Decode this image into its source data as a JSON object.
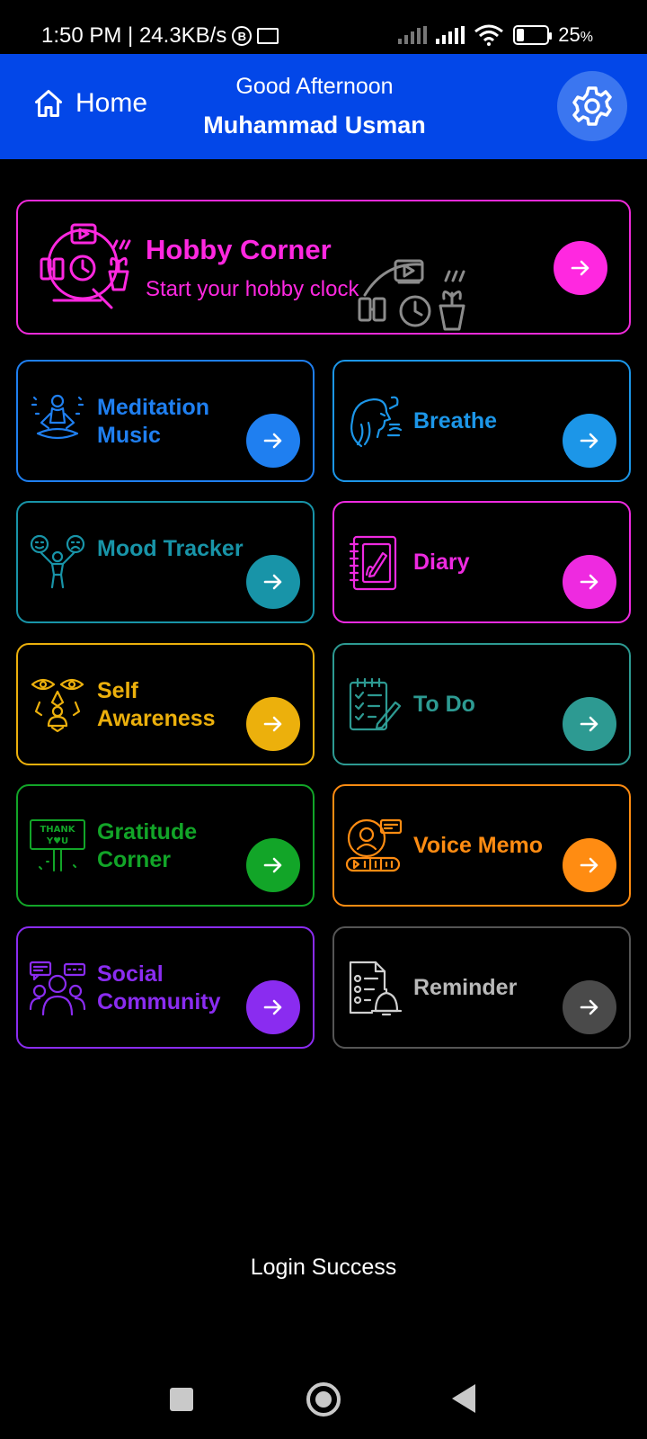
{
  "status_bar": {
    "time_text": "1:50 PM | 24.3KB/s",
    "mini_icon_letter": "B",
    "battery_text": "25",
    "battery_unit": "%",
    "battery_level": 0.25
  },
  "header": {
    "home_label": "Home",
    "greeting": "Good Afternoon",
    "username": "Muhammad Usman",
    "background_color": "#0347e8"
  },
  "hobby": {
    "title": "Hobby Corner",
    "subtitle": "Start your hobby clock",
    "color": "#ff28e0",
    "icon": "hobby-clock-icon"
  },
  "cards": [
    {
      "title": "Meditation Music",
      "color": "#1f7ff0",
      "icon": "meditation-icon"
    },
    {
      "title": "Breathe",
      "color": "#1c96e8",
      "icon": "breathe-icon"
    },
    {
      "title": "Mood Tracker",
      "color": "#1894a8",
      "icon": "mood-tracker-icon"
    },
    {
      "title": "Diary",
      "color": "#ee2ae0",
      "icon": "diary-icon"
    },
    {
      "title": "Self Awareness",
      "color": "#ecb00c",
      "icon": "self-awareness-icon"
    },
    {
      "title": "To Do",
      "color": "#2d9a92",
      "icon": "todo-list-icon"
    },
    {
      "title": "Gratitude Corner",
      "color": "#12a528",
      "icon": "thank-you-sign-icon"
    },
    {
      "title": "Voice Memo",
      "color": "#ff8c12",
      "icon": "voice-memo-icon"
    },
    {
      "title": "Social Community",
      "color": "#8a2cf0",
      "icon": "social-community-icon"
    },
    {
      "title": "Reminder",
      "color": "#b9b9b9",
      "icon": "reminder-icon"
    }
  ],
  "login_message": "Login Success"
}
